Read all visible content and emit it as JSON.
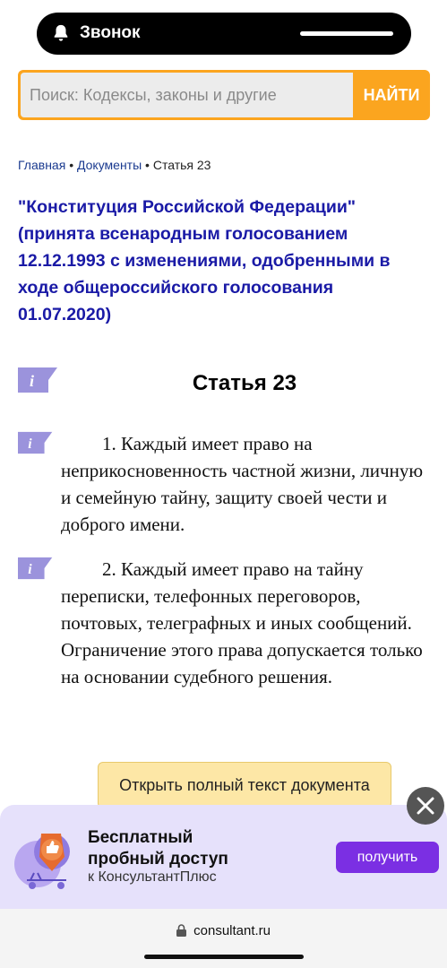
{
  "call": {
    "label": "Звонок"
  },
  "search": {
    "placeholder": "Поиск: Кодексы, законы и другие",
    "button_label": "НАЙТИ"
  },
  "breadcrumb": {
    "items": [
      "Главная",
      "Документы",
      "Статья 23"
    ],
    "separator": "•"
  },
  "document": {
    "title": "\"Конституция Российской Федерации\" (принята всенародным голосованием 12.12.1993 с изменениями, одобренными в ходе общероссийского голосования 01.07.2020)"
  },
  "article": {
    "title": "Статья 23",
    "paragraphs": [
      "1. Каждый имеет право на неприкосновенность частной жизни, личную и семейную тайну, защиту своей чести и доброго имени.",
      "2. Каждый имеет право на тайну переписки, телефонных переговоров, почтовых, телеграфных и иных сообщений. Ограничение этого права допускается только на основании судебного решения."
    ]
  },
  "open_full_text_label": "Открыть полный текст документа",
  "banner": {
    "line1": "Бесплатный",
    "line2": "пробный доступ",
    "line3": "к КонсультантПлюс",
    "button_label": "получить"
  },
  "browser": {
    "url": "consultant.ru"
  },
  "icons": {
    "call": "bell-icon",
    "info": "info-icon",
    "close": "close-icon",
    "lock": "lock-icon",
    "promo": "thumbs-up-illustration"
  },
  "colors": {
    "accent_orange": "#fba51f",
    "title_blue": "#1a1aa6",
    "link_blue": "#1a3a8f",
    "info_icon": "#9b93dc",
    "banner_bg": "#e6e1fb",
    "promo_button": "#7b2fe3",
    "open_button_bg": "#fde7a6"
  }
}
